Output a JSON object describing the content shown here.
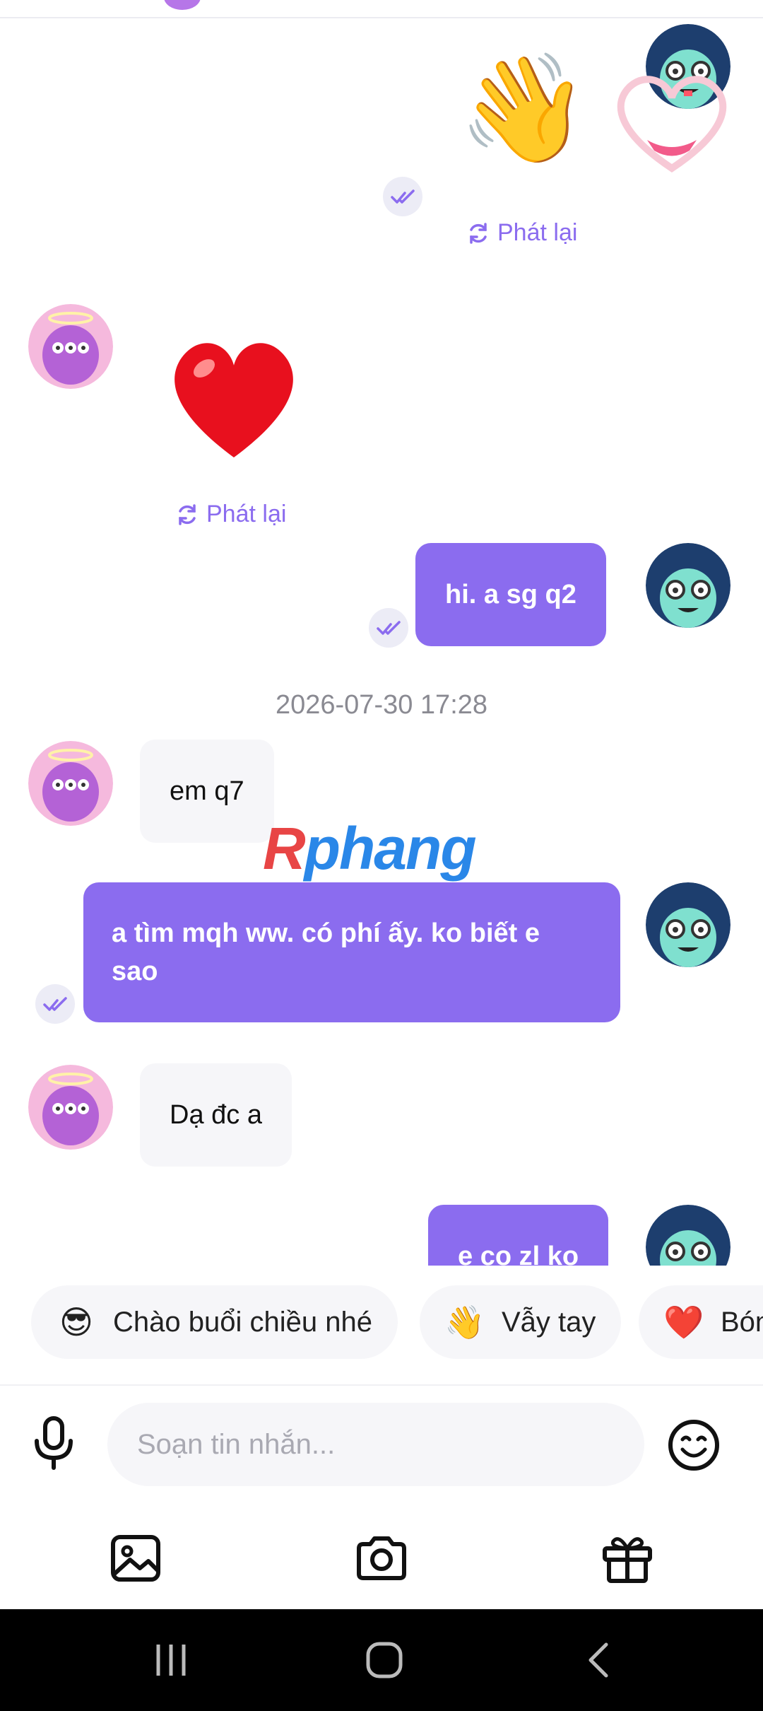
{
  "chat": {
    "messages": [
      {
        "kind": "sticker",
        "from": "me",
        "emoji": "👋",
        "replay_label": "Phát lại"
      },
      {
        "kind": "sticker",
        "from": "them",
        "emoji": "❤️",
        "replay_label": "Phát lại"
      },
      {
        "kind": "text",
        "from": "me",
        "text": "hi. a sg q2"
      },
      {
        "kind": "timestamp",
        "text": "2026-07-30 17:28"
      },
      {
        "kind": "text",
        "from": "them",
        "text": "em q7"
      },
      {
        "kind": "text",
        "from": "me",
        "text": "a tìm mqh ww. có phí ấy. ko biết e sao"
      },
      {
        "kind": "text",
        "from": "them",
        "text": "Dạ đc a"
      },
      {
        "kind": "text",
        "from": "me",
        "text": "e co zl ko"
      }
    ]
  },
  "watermark": {
    "part1": "R",
    "part2": "phang"
  },
  "suggestions": [
    {
      "emoji": "😎",
      "label": "Chào buổi chiều nhé"
    },
    {
      "emoji": "👋",
      "label": "Vẫy tay"
    },
    {
      "emoji": "❤️",
      "label": "Bóng"
    }
  ],
  "composer": {
    "placeholder": "Soạn tin nhắn..."
  },
  "icons": {
    "mic": "microphone-icon",
    "emoji": "smiley-icon",
    "gallery": "image-icon",
    "camera": "camera-icon",
    "gift": "gift-icon",
    "read": "double-check-icon",
    "replay": "refresh-icon"
  },
  "colors": {
    "accent": "#8b6cef",
    "incoming_bubble": "#f6f6f9",
    "timestamp": "#8a8a92"
  }
}
